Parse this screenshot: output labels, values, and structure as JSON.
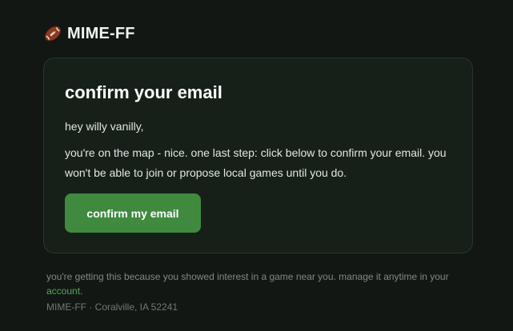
{
  "brand": {
    "name": "MIME-FF",
    "icon": "football-icon"
  },
  "card": {
    "title": "confirm your email",
    "greeting": "hey willy vanilly,",
    "body": "you're on the map - nice. one last step: click below to confirm your email. you won't be able to join or propose local games until you do.",
    "button_label": "confirm my email"
  },
  "footer": {
    "notice_prefix": "you're getting this because you showed interest in a game near you. manage it anytime in your",
    "account_link": "account",
    "notice_suffix": ".",
    "address": "MIME-FF · Coralville, IA 52241"
  },
  "colors": {
    "background": "#121714",
    "card": "#162019",
    "accent": "#3f8a3f",
    "link": "#5aa55a"
  }
}
